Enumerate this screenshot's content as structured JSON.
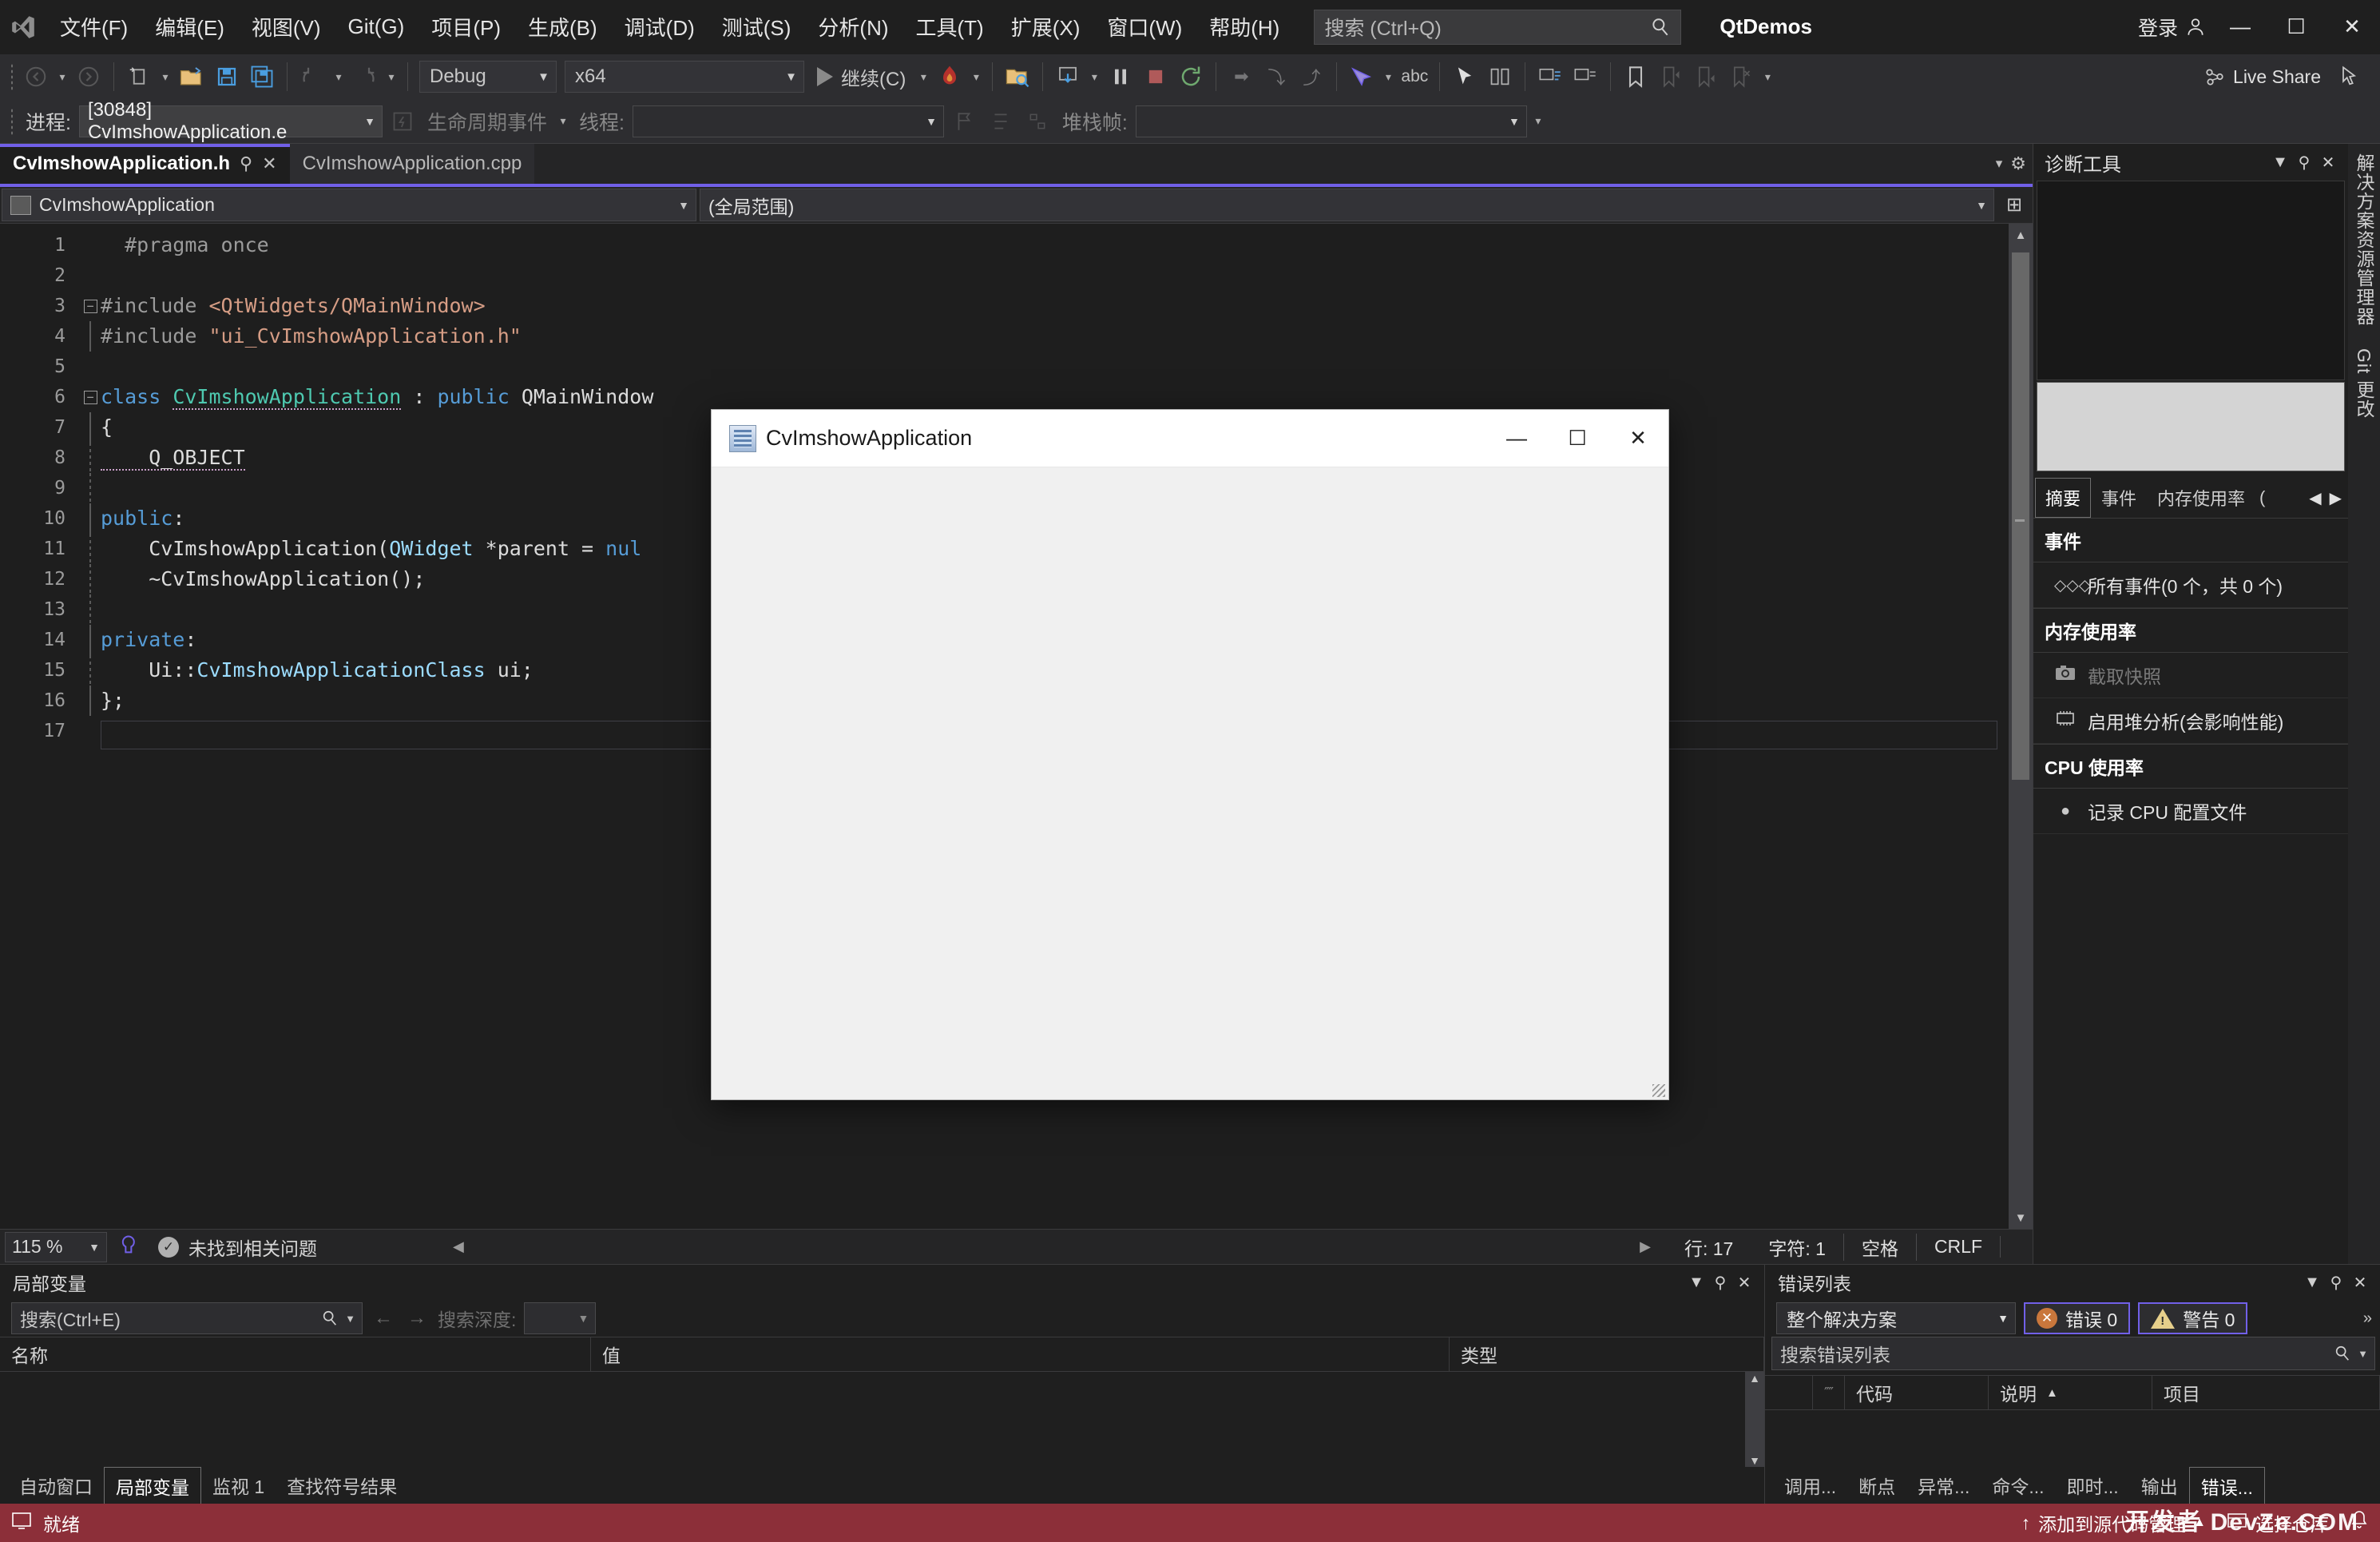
{
  "titlebar": {
    "logo_icon": "visual-studio-logo",
    "menus": [
      "文件(F)",
      "编辑(E)",
      "视图(V)",
      "Git(G)",
      "项目(P)",
      "生成(B)",
      "调试(D)",
      "测试(S)",
      "分析(N)",
      "工具(T)",
      "扩展(X)",
      "窗口(W)",
      "帮助(H)"
    ],
    "search_placeholder": "搜索 (Ctrl+Q)",
    "search_icon": "magnifier-icon",
    "project_title": "QtDemos",
    "signin_label": "登录",
    "signin_icon": "person-icon",
    "minimize_label": "—",
    "maximize_label": "☐",
    "close_label": "✕"
  },
  "toolbar": {
    "back_icon": "navigate-back-icon",
    "forward_icon": "navigate-forward-icon",
    "new_item_icon": "new-item-icon",
    "open_icon": "open-file-icon",
    "save_icon": "save-icon",
    "save_all_icon": "save-all-icon",
    "undo_icon": "undo-icon",
    "redo_icon": "redo-icon",
    "config_value": "Debug",
    "platform_value": "x64",
    "continue_label": "继续(C)",
    "hot_reload_icon": "hot-reload-icon",
    "icons_right": [
      "attach-to-process-icon",
      "step-into-icon",
      "break-all-icon",
      "stop-icon",
      "restart-icon",
      "show-next-statement-icon",
      "step-over-icon",
      "step-out-icon",
      "toolbar-options-icon",
      "comment-icon",
      "bookmark-icon",
      "pointer-icon"
    ],
    "live_share_label": "Live Share",
    "live_share_icon": "live-share-icon",
    "feedback_icon": "feedback-icon"
  },
  "debugbar": {
    "process_label": "进程:",
    "process_value": "[30848] CvImshowApplication.e",
    "lifecycle_icon": "lifecycle-events-icon",
    "lifecycle_label": "生命周期事件",
    "thread_label": "线程:",
    "thread_value": "",
    "flag_icon": "flag-icon",
    "stack_label": "堆栈帧:",
    "stack_value": ""
  },
  "editor": {
    "tabs": [
      {
        "label": "CvImshowApplication.h",
        "active": true,
        "pin_icon": "pin-icon",
        "close_icon": "close-icon"
      },
      {
        "label": "CvImshowApplication.cpp",
        "active": false
      }
    ],
    "nav_left": "CvImshowApplication",
    "nav_left_icon": "class-icon",
    "nav_right": "(全局范围)",
    "nav_split_icon": "split-editor-icon",
    "code_lines": [
      {
        "n": 1,
        "fold": "none",
        "indent": 1,
        "text": "#pragma once",
        "kind": "pragma"
      },
      {
        "n": 2,
        "fold": "none",
        "indent": 0,
        "text": "",
        "kind": "blank"
      },
      {
        "n": 3,
        "fold": "minus",
        "indent": 0,
        "text": "#include <QtWidgets/QMainWindow>",
        "kind": "include_angle"
      },
      {
        "n": 4,
        "fold": "bar",
        "indent": 0,
        "text": "#include \"ui_CvImshowApplication.h\"",
        "kind": "include_quote"
      },
      {
        "n": 5,
        "fold": "none",
        "indent": 0,
        "text": "",
        "kind": "blank"
      },
      {
        "n": 6,
        "fold": "minus",
        "indent": 0,
        "text": "class CvImshowApplication : public QMainWindow",
        "kind": "class_decl"
      },
      {
        "n": 7,
        "fold": "bar",
        "indent": 0,
        "text": "{",
        "kind": "plain"
      },
      {
        "n": 8,
        "fold": "dash",
        "indent": 1,
        "text": "Q_OBJECT",
        "kind": "macro"
      },
      {
        "n": 9,
        "fold": "dash",
        "indent": 0,
        "text": "",
        "kind": "blank"
      },
      {
        "n": 10,
        "fold": "bar",
        "indent": 0,
        "text": "public:",
        "kind": "access"
      },
      {
        "n": 11,
        "fold": "dash",
        "indent": 1,
        "text": "CvImshowApplication(QWidget *parent = nul",
        "kind": "ctor"
      },
      {
        "n": 12,
        "fold": "dash",
        "indent": 1,
        "text": "~CvImshowApplication();",
        "kind": "dtor"
      },
      {
        "n": 13,
        "fold": "dash",
        "indent": 0,
        "text": "",
        "kind": "blank"
      },
      {
        "n": 14,
        "fold": "bar",
        "indent": 0,
        "text": "private:",
        "kind": "access"
      },
      {
        "n": 15,
        "fold": "dash",
        "indent": 1,
        "text": "Ui::CvImshowApplicationClass ui;",
        "kind": "member"
      },
      {
        "n": 16,
        "fold": "bar",
        "indent": 0,
        "text": "};",
        "kind": "plain"
      },
      {
        "n": 17,
        "fold": "none",
        "indent": 0,
        "text": "",
        "kind": "current"
      }
    ],
    "status": {
      "zoom": "115 %",
      "hand_icon": "intellicode-icon",
      "issue_icon": "check-circle-icon",
      "issue_text": "未找到相关问题",
      "scroll_left_icon": "◀",
      "scroll_right_icon": "▶",
      "line_label": "行: 17",
      "char_label": "字符: 1",
      "indent_label": "空格",
      "eol_label": "CRLF"
    }
  },
  "diagnostics": {
    "title": "诊断工具",
    "dropdown_icon": "chevron-down-icon",
    "pin_icon": "pin-icon",
    "close_icon": "close-icon",
    "tabs": [
      "摘要",
      "事件",
      "内存使用率"
    ],
    "active_tab": "摘要",
    "tab_overflow": "(",
    "prev_icon": "◀",
    "next_icon": "▶",
    "sections": [
      {
        "header": "事件",
        "rows": [
          {
            "icon": "events-icon",
            "glyph": "◇◇◇",
            "label": "所有事件(0 个，共 0 个)",
            "dim": false
          }
        ]
      },
      {
        "header": "内存使用率",
        "rows": [
          {
            "icon": "camera-icon",
            "glyph": "▣",
            "label": "截取快照",
            "dim": true
          },
          {
            "icon": "heap-icon",
            "glyph": "▥",
            "label": "启用堆分析(会影响性能)",
            "dim": false
          }
        ]
      },
      {
        "header": "CPU 使用率",
        "rows": [
          {
            "icon": "record-icon",
            "glyph": "●",
            "label": "记录 CPU 配置文件",
            "dim": false
          }
        ]
      }
    ]
  },
  "vertical_tabs": [
    "解决方案资源管理器",
    "Git 更改"
  ],
  "locals_panel": {
    "title": "局部变量",
    "dropdown_icon": "chevron-down-icon",
    "pin_icon": "pin-icon",
    "close_icon": "close-icon",
    "search_placeholder": "搜索(Ctrl+E)",
    "search_icon": "magnifier-icon",
    "prev_icon": "←",
    "next_icon": "→",
    "depth_label": "搜索深度:",
    "depth_value": "",
    "columns": [
      "名称",
      "值",
      "类型"
    ],
    "rows": [],
    "tabs": [
      "自动窗口",
      "局部变量",
      "监视 1",
      "查找符号结果"
    ],
    "active_tab": "局部变量"
  },
  "errorlist_panel": {
    "title": "错误列表",
    "dropdown_icon": "chevron-down-icon",
    "pin_icon": "pin-icon",
    "close_icon": "close-icon",
    "scope_value": "整个解决方案",
    "error_badge": "错误 0",
    "warning_badge": "警告 0",
    "error_icon": "error-circle-icon",
    "warning_icon": "warning-triangle-icon",
    "overflow_icon": "»",
    "search_placeholder": "搜索错误列表",
    "search_icon": "magnifier-icon",
    "columns": [
      "",
      "代码",
      "说明",
      "项目"
    ],
    "sort_icon": "▲",
    "rows": [],
    "tabs": [
      "调用...",
      "断点",
      "异常...",
      "命令...",
      "即时...",
      "输出",
      "错误..."
    ],
    "active_tab": "错误..."
  },
  "statusbar": {
    "ready_icon": "ready-icon",
    "ready_label": "就绪",
    "source_control_icon": "↑",
    "source_control_label": "添加到源代码管理",
    "source_control_caret": "▲",
    "repo_icon": "repo-icon",
    "repo_label": "选择仓库",
    "bell_icon": "bell-icon"
  },
  "qt_window": {
    "title": "CvImshowApplication",
    "app_icon": "qt-app-icon",
    "minimize_label": "—",
    "maximize_label": "☐",
    "close_label": "✕",
    "resize_grip_icon": "resize-grip-icon"
  },
  "watermark": "开发者 DevZe.COM"
}
